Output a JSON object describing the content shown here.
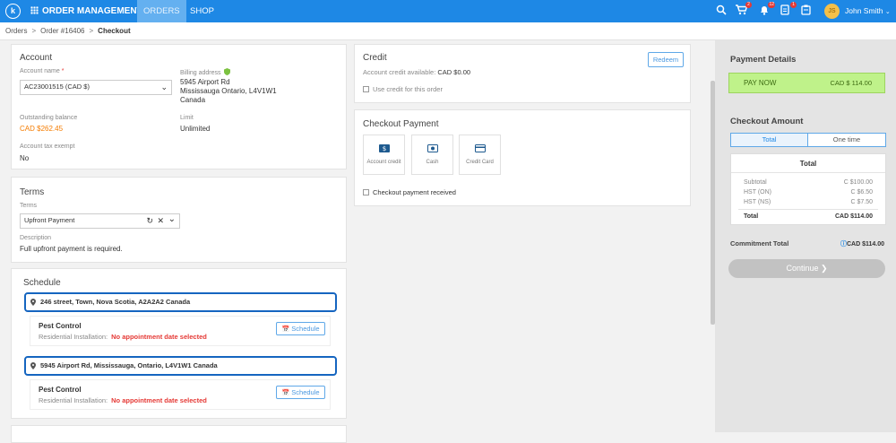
{
  "topbar": {
    "logo_letter": "k",
    "apps_label": "ORDER MANAGEMENT",
    "tabs": [
      {
        "label": "ORDERS"
      },
      {
        "label": "SHOP"
      }
    ],
    "cart_badge": "2",
    "bell_badge": "12",
    "doc_badge": "1",
    "avatar_initials": "JS",
    "user_name": "John Smith"
  },
  "breadcrumb": {
    "items": [
      "Orders",
      "Order #16406",
      "Checkout"
    ]
  },
  "account": {
    "title": "Account",
    "account_name_label": "Account name",
    "required_mark": "*",
    "account_name_value": "AC23001515 (CAD $)",
    "billing_label": "Billing address",
    "billing_line1": "5945 Airport Rd",
    "billing_line2": "Mississauga Ontario, L4V1W1",
    "billing_line3": "Canada",
    "outstanding_label": "Outstanding balance",
    "outstanding_value": "CAD $262.45",
    "limit_label": "Limit",
    "limit_value": "Unlimited",
    "tax_label": "Account tax exempt",
    "tax_value": "No"
  },
  "terms": {
    "title": "Terms",
    "terms_label": "Terms",
    "terms_value": "Upfront Payment",
    "description_label": "Description",
    "description_value": "Full upfront payment is required."
  },
  "schedule": {
    "title": "Schedule",
    "groups": [
      {
        "address": "246 street, Town, Nova Scotia, A2A2A2 Canada",
        "service": "Pest Control",
        "sub": "Residential Installation:",
        "status": "No appointment date selected",
        "button": "Schedule"
      },
      {
        "address": "5945 Airport Rd, Mississauga, Ontario, L4V1W1 Canada",
        "service": "Pest Control",
        "sub": "Residential Installation:",
        "status": "No appointment date selected",
        "button": "Schedule"
      }
    ]
  },
  "credit": {
    "title": "Credit",
    "available_label": "Account credit available:",
    "available_value": "CAD $0.00",
    "use_credit_label": "Use credit for this order",
    "redeem_label": "Redeem"
  },
  "checkout_payment": {
    "title": "Checkout Payment",
    "methods": [
      {
        "label": "Account credit"
      },
      {
        "label": "Cash"
      },
      {
        "label": "Credit Card"
      }
    ],
    "received_label": "Checkout payment received"
  },
  "payment_details": {
    "title": "Payment Details",
    "pay_now_label": "PAY NOW",
    "pay_now_value": "CAD $ 114.00"
  },
  "checkout_amount": {
    "title": "Checkout Amount",
    "toggle": [
      {
        "label": "Total"
      },
      {
        "label": "One time"
      }
    ],
    "table_header": "Total",
    "rows": [
      {
        "label": "Subtotal",
        "value": "C $100.00"
      },
      {
        "label": "HST (ON)",
        "value": "C $6.50"
      },
      {
        "label": "HST (NS)",
        "value": "C $7.50"
      }
    ],
    "total_label": "Total",
    "total_value": "CAD $114.00",
    "commitment_label": "Commitment Total",
    "commitment_value": "CAD $114.00",
    "continue_label": "Continue"
  },
  "colors": {
    "primary": "#1e88e5",
    "active_tab": "#64b0f0",
    "warning_orange": "#f57c00",
    "error_red": "#e53935",
    "pay_now_bg": "#bff28a",
    "highlight_border": "#1565c0"
  }
}
